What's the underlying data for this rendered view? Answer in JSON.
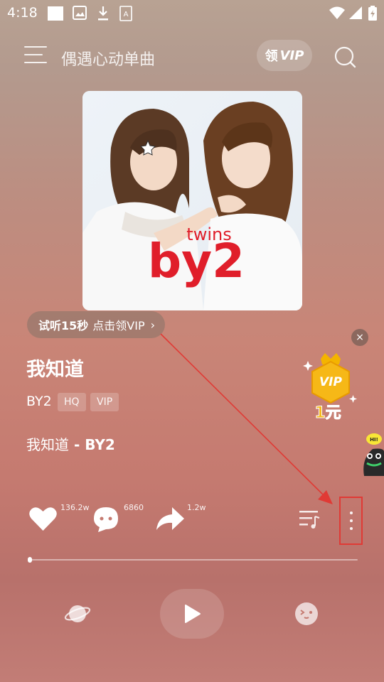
{
  "status_bar": {
    "time": "4:18",
    "icons": [
      "notification-square-icon",
      "image-icon",
      "download-icon",
      "text-icon",
      "wifi-icon",
      "cellular-icon",
      "battery-icon"
    ]
  },
  "header": {
    "title": "偶遇心动单曲",
    "vip_prefix": "领",
    "vip_word": "VIP"
  },
  "album": {
    "cover_text_small": "twins",
    "cover_text_big": "by2",
    "brand_color": "#e01e2a"
  },
  "trial": {
    "bold": "试听15秒",
    "text": "点击领VIP",
    "chevron": "›"
  },
  "song": {
    "title": "我知道",
    "artist": "BY2",
    "tags": [
      "HQ",
      "VIP"
    ],
    "lyric_title": "我知道",
    "lyric_sep": " - ",
    "lyric_artist": "BY2"
  },
  "promo": {
    "close": "×",
    "badge_top": "VIP",
    "badge_bottom": "1元",
    "mascot_label": "HI!"
  },
  "actions": {
    "like_count": "136.2w",
    "comment_count": "6860",
    "share_count": "1.2w"
  },
  "player": {
    "progress": 0.0
  },
  "colors": {
    "annotation_red": "#e03a35",
    "badge_gold": "#f4b400"
  }
}
